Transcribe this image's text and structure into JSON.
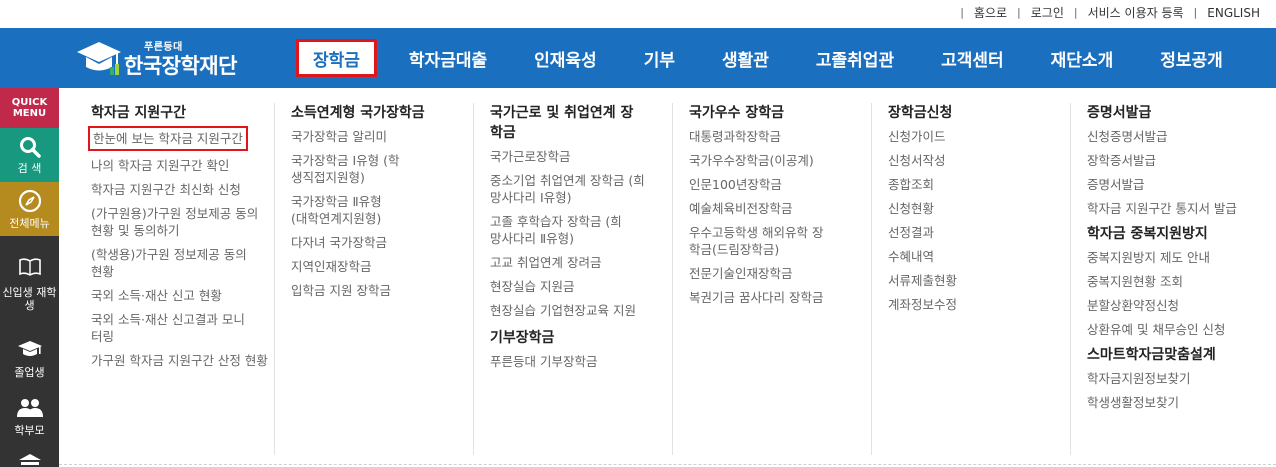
{
  "top_links": [
    "홈으로",
    "로그인",
    "서비스 이용자 등록",
    "ENGLISH"
  ],
  "logo": {
    "small": "푸른등대",
    "main": "한국장학재단"
  },
  "gnb": [
    {
      "label": "장학금",
      "active": true
    },
    {
      "label": "학자금대출"
    },
    {
      "label": "인재육성"
    },
    {
      "label": "기부"
    },
    {
      "label": "생활관"
    },
    {
      "label": "고졸취업관"
    },
    {
      "label": "고객센터"
    },
    {
      "label": "재단소개"
    },
    {
      "label": "정보공개"
    }
  ],
  "quick": {
    "title": "QUICK MENU",
    "items": [
      "검 색",
      "전체메뉴",
      "신입생 재학생",
      "졸업생",
      "학부모"
    ]
  },
  "columns": [
    {
      "sections": [
        {
          "heading": "학자금 지원구간",
          "links": [
            "한눈에 보는 학자금 지원구간",
            "나의 학자금 지원구간 확인",
            "학자금 지원구간 최신화 신청",
            "(가구원용)가구원 정보제공 동의현황 및 동의하기",
            "(학생용)가구원 정보제공 동의현황",
            "국외 소득·재산 신고 현황",
            "국외 소득·재산 신고결과 모니터링",
            "가구원 학자금 지원구간 산정 현황"
          ]
        }
      ]
    },
    {
      "sections": [
        {
          "heading": "소득연계형 국가장학금",
          "links": [
            "국가장학금 알리미",
            "국가장학금 Ⅰ유형 (학생직접지원형)",
            "국가장학금 Ⅱ유형 (대학연계지원형)",
            "다자녀 국가장학금",
            "지역인재장학금",
            "입학금 지원 장학금"
          ]
        }
      ]
    },
    {
      "sections": [
        {
          "heading": "국가근로 및 취업연계 장학금",
          "links": [
            "국가근로장학금",
            "중소기업 취업연계 장학금 (희망사다리 Ⅰ유형)",
            "고졸 후학습자 장학금 (희망사다리 Ⅱ유형)",
            "고교 취업연계 장려금",
            "현장실습 지원금",
            "현장실습 기업현장교육 지원"
          ]
        },
        {
          "heading": "기부장학금",
          "links": [
            "푸른등대 기부장학금"
          ]
        }
      ]
    },
    {
      "sections": [
        {
          "heading": "국가우수 장학금",
          "links": [
            "대통령과학장학금",
            "국가우수장학금(이공계)",
            "인문100년장학금",
            "예술체육비전장학금",
            "우수고등학생 해외유학 장학금(드림장학금)",
            "전문기술인재장학금",
            "복권기금 꿈사다리 장학금"
          ]
        }
      ]
    },
    {
      "sections": [
        {
          "heading": "장학금신청",
          "links": [
            "신청가이드",
            "신청서작성",
            "종합조회",
            "신청현황",
            "선정결과",
            "수혜내역",
            "서류제출현황",
            "계좌정보수정"
          ]
        }
      ]
    },
    {
      "sections": [
        {
          "heading": "증명서발급",
          "links": [
            "신청증명서발급",
            "장학증서발급",
            "증명서발급",
            "학자금 지원구간 통지서 발급"
          ]
        },
        {
          "heading": "학자금 중복지원방지",
          "links": [
            "중복지원방지 제도 안내",
            "중복지원현황 조회",
            "분할상환약정신청",
            "상환유예 및 채무승인 신청"
          ]
        },
        {
          "heading": "스마트학자금맞춤설계",
          "links": [
            "학자금지원정보찾기",
            "학생생활정보찾기"
          ]
        }
      ]
    }
  ]
}
